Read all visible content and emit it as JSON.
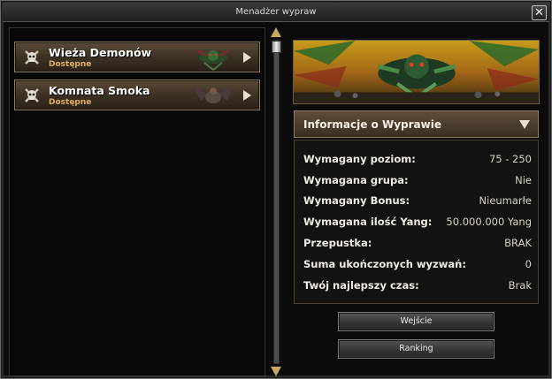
{
  "window": {
    "title": "Menadżer wypraw",
    "close_label": "✕"
  },
  "dungeons": [
    {
      "name": "Wieża Demonów",
      "status": "Dostępne"
    },
    {
      "name": "Komnata Smoka",
      "status": "Dostępne"
    }
  ],
  "info": {
    "header": "Informacje o Wyprawie",
    "rows": [
      {
        "label": "Wymagany poziom:",
        "value": "75 - 250"
      },
      {
        "label": "Wymagana grupa:",
        "value": "Nie"
      },
      {
        "label": "Wymagany Bonus:",
        "value": "Nieumarłe"
      },
      {
        "label": "Wymagana ilość Yang:",
        "value": "50.000.000 Yang"
      },
      {
        "label": "Przepustka:",
        "value": "BRAK"
      },
      {
        "label": "Suma ukończonych wyzwań:",
        "value": "0"
      },
      {
        "label": "Twój najlepszy czas:",
        "value": "Brak"
      }
    ]
  },
  "buttons": {
    "enter": "Wejście",
    "ranking": "Ranking"
  },
  "colors": {
    "accent_gold": "#e0b060",
    "item_bg": "#3b2f22"
  }
}
